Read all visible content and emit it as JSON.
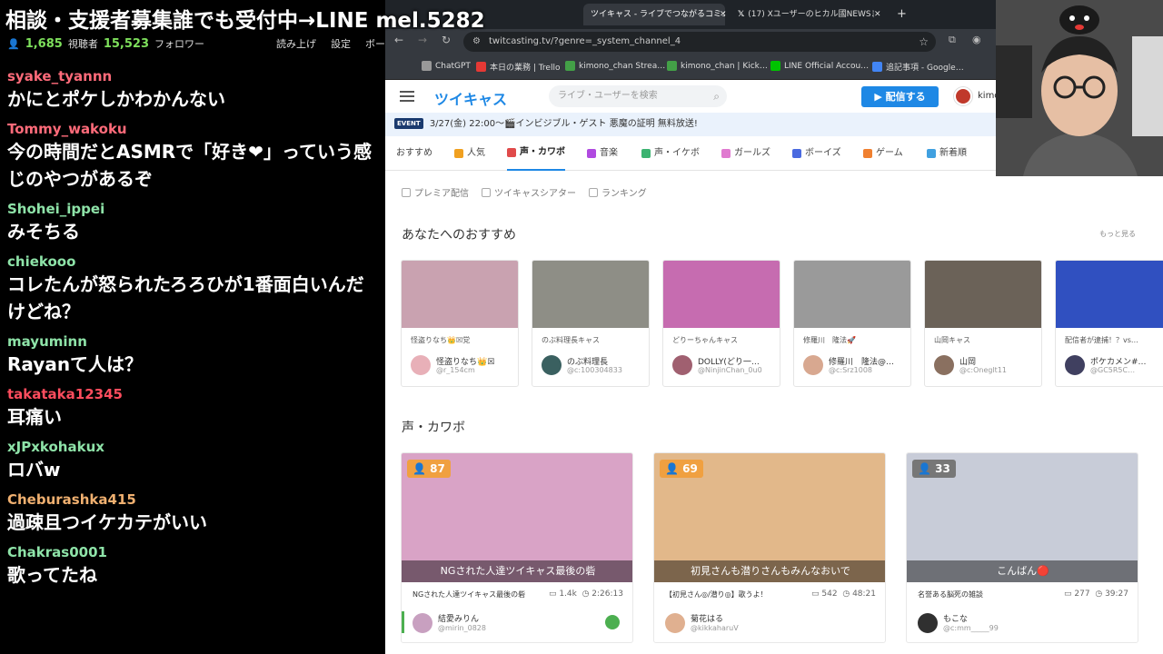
{
  "banner": "相談・支援者募集誰でも受付中→LINE mel.5282",
  "chat_top": {
    "followers_count": "1,685",
    "followers_label": "視聴者",
    "follows_count": "15,523",
    "follows_label": "フォロワー",
    "read_label": "読み上げ",
    "settings_label": "設定",
    "other_label": "ボー"
  },
  "chat": [
    {
      "user": "syake_tyannn",
      "color": "#ff6b7a",
      "text": "かにとポケしかわかんない"
    },
    {
      "user": "Tommy_wakoku",
      "color": "#ff6b7a",
      "text": "今の時間だとASMRで「好き❤」っていう感じのやつがあるぞ"
    },
    {
      "user": "Shohei_ippei",
      "color": "#8ee3a8",
      "text": "みそちる"
    },
    {
      "user": "chiekooo",
      "color": "#8ee3a8",
      "text": "コレたんが怒られたろろひが1番面白いんだけどね？"
    },
    {
      "user": "mayuminn",
      "color": "#8ee3a8",
      "text": "Rayanて人は？"
    },
    {
      "user": "takataka12345",
      "color": "#ff4d5e",
      "text": "耳痛い"
    },
    {
      "user": "xJPxkohakux",
      "color": "#8ee3a8",
      "text": "ロバw"
    },
    {
      "user": "Cheburashka415",
      "color": "#f0b070",
      "text": "過疎且つイケカテがいい"
    },
    {
      "user": "Chakras0001",
      "color": "#8ee3a8",
      "text": "歌ってたね"
    }
  ],
  "browser": {
    "tabs": [
      {
        "label": "ツイキャス - ライブでつながるコミュニ…",
        "active": true
      },
      {
        "label": "(17) Xユーザーのヒカル國NEWSまと…",
        "active": false
      }
    ],
    "new_tab": "+",
    "url": "twitcasting.tv/?genre=_system_channel_4",
    "bookmarks": [
      {
        "label": "ChatGPT",
        "color": "#999"
      },
      {
        "label": "本日の業務 | Trello",
        "color": "#e53935"
      },
      {
        "label": "kimono_chan Strea…",
        "color": "#43a047"
      },
      {
        "label": "kimono_chan | Kick…",
        "color": "#43a047"
      },
      {
        "label": "LINE Official Accou…",
        "color": "#00c300"
      },
      {
        "label": "追記事項 - Google…",
        "color": "#4285f4"
      }
    ]
  },
  "site": {
    "logo": "ツイキャス",
    "search_placeholder": "ライブ・ユーザーを検索",
    "stream_button": "配信する",
    "user_name": "kimo",
    "event_tag": "EVENT",
    "event_text": "3/27(金) 22:00～🎬インビジブル・ゲスト 悪魔の証明 無料放送!",
    "genres": [
      {
        "label": "おすすめ",
        "color": "",
        "active": false
      },
      {
        "label": "人気",
        "color": "#f0a020",
        "active": false
      },
      {
        "label": "声・カワボ",
        "color": "#e04a4a",
        "active": true
      },
      {
        "label": "音楽",
        "color": "#b04ae0",
        "active": false
      },
      {
        "label": "声・イケボ",
        "color": "#3cb371",
        "active": false
      },
      {
        "label": "ガールズ",
        "color": "#e07ad0",
        "active": false
      },
      {
        "label": "ボーイズ",
        "color": "#4a6ae0",
        "active": false
      },
      {
        "label": "ゲーム",
        "color": "#f08030",
        "active": false
      },
      {
        "label": "新着順",
        "color": "#40a0e0",
        "active": false
      }
    ],
    "subnav": [
      "プレミア配信",
      "ツイキャスシアター",
      "ランキング"
    ],
    "rec_title": "あなたへのおすすめ",
    "more_label": "もっと見る",
    "rec_cards": [
      {
        "title": "怪盗りなち👑☒党",
        "name": "怪盗りなち👑☒",
        "id": "@r_154cm",
        "thumb": "#c9a2b0",
        "avatar": "#e8b0b8"
      },
      {
        "title": "のぶ料理長キャス",
        "name": "のぶ料理長",
        "id": "@c:100304833",
        "thumb": "#8e8e86",
        "avatar": "#3a6060"
      },
      {
        "title": "どりーちゃんキャス",
        "name": "DOLLY(どり一…",
        "id": "@NinjinChan_0u0",
        "thumb": "#c66cb0",
        "avatar": "#a06070"
      },
      {
        "title": "修羅川　隆法🚀",
        "name": "修羅川　隆法@…",
        "id": "@c:Srz1008",
        "thumb": "#9a9a9a",
        "avatar": "#d8a890"
      },
      {
        "title": "山岡キャス",
        "name": "山岡",
        "id": "@c:Oneglt11",
        "thumb": "#6b6258",
        "avatar": "#8a7060"
      },
      {
        "title": "配信者が逮捕！？vs…",
        "name": "ポケカメン#…",
        "id": "@GC5R5C…",
        "thumb": "#3050c0",
        "avatar": "#404060"
      }
    ],
    "section_title": "声・カワボ",
    "live_cards": [
      {
        "viewers": "87",
        "caption": "NGされた人達ツイキャス最後の砦",
        "title": "NGされた人達ツイキャス最後の砦",
        "comments": "1.4k",
        "time": "2:26:13",
        "name": "結愛みりん",
        "id": "@mirin_0828",
        "thumb": "#d9a3c6",
        "avatar": "#c8a0c0",
        "badge": "orange"
      },
      {
        "viewers": "69",
        "caption": "初見さんも潜りさんもみんなおいで",
        "title": "【初見さん◎/潜り◎】歌うよ！",
        "comments": "542",
        "time": "48:21",
        "name": "菊花はる",
        "id": "@kikkaharuV",
        "thumb": "#e2b88a",
        "avatar": "#e0b090",
        "badge": "orange"
      },
      {
        "viewers": "33",
        "caption": "こんばん🔴",
        "title": "名誉ある脳死の雑談",
        "comments": "277",
        "time": "39:27",
        "name": "もこな",
        "id": "@c:mm_____99",
        "thumb": "#c8ccd8",
        "avatar": "#303030",
        "badge": "gray"
      }
    ]
  }
}
